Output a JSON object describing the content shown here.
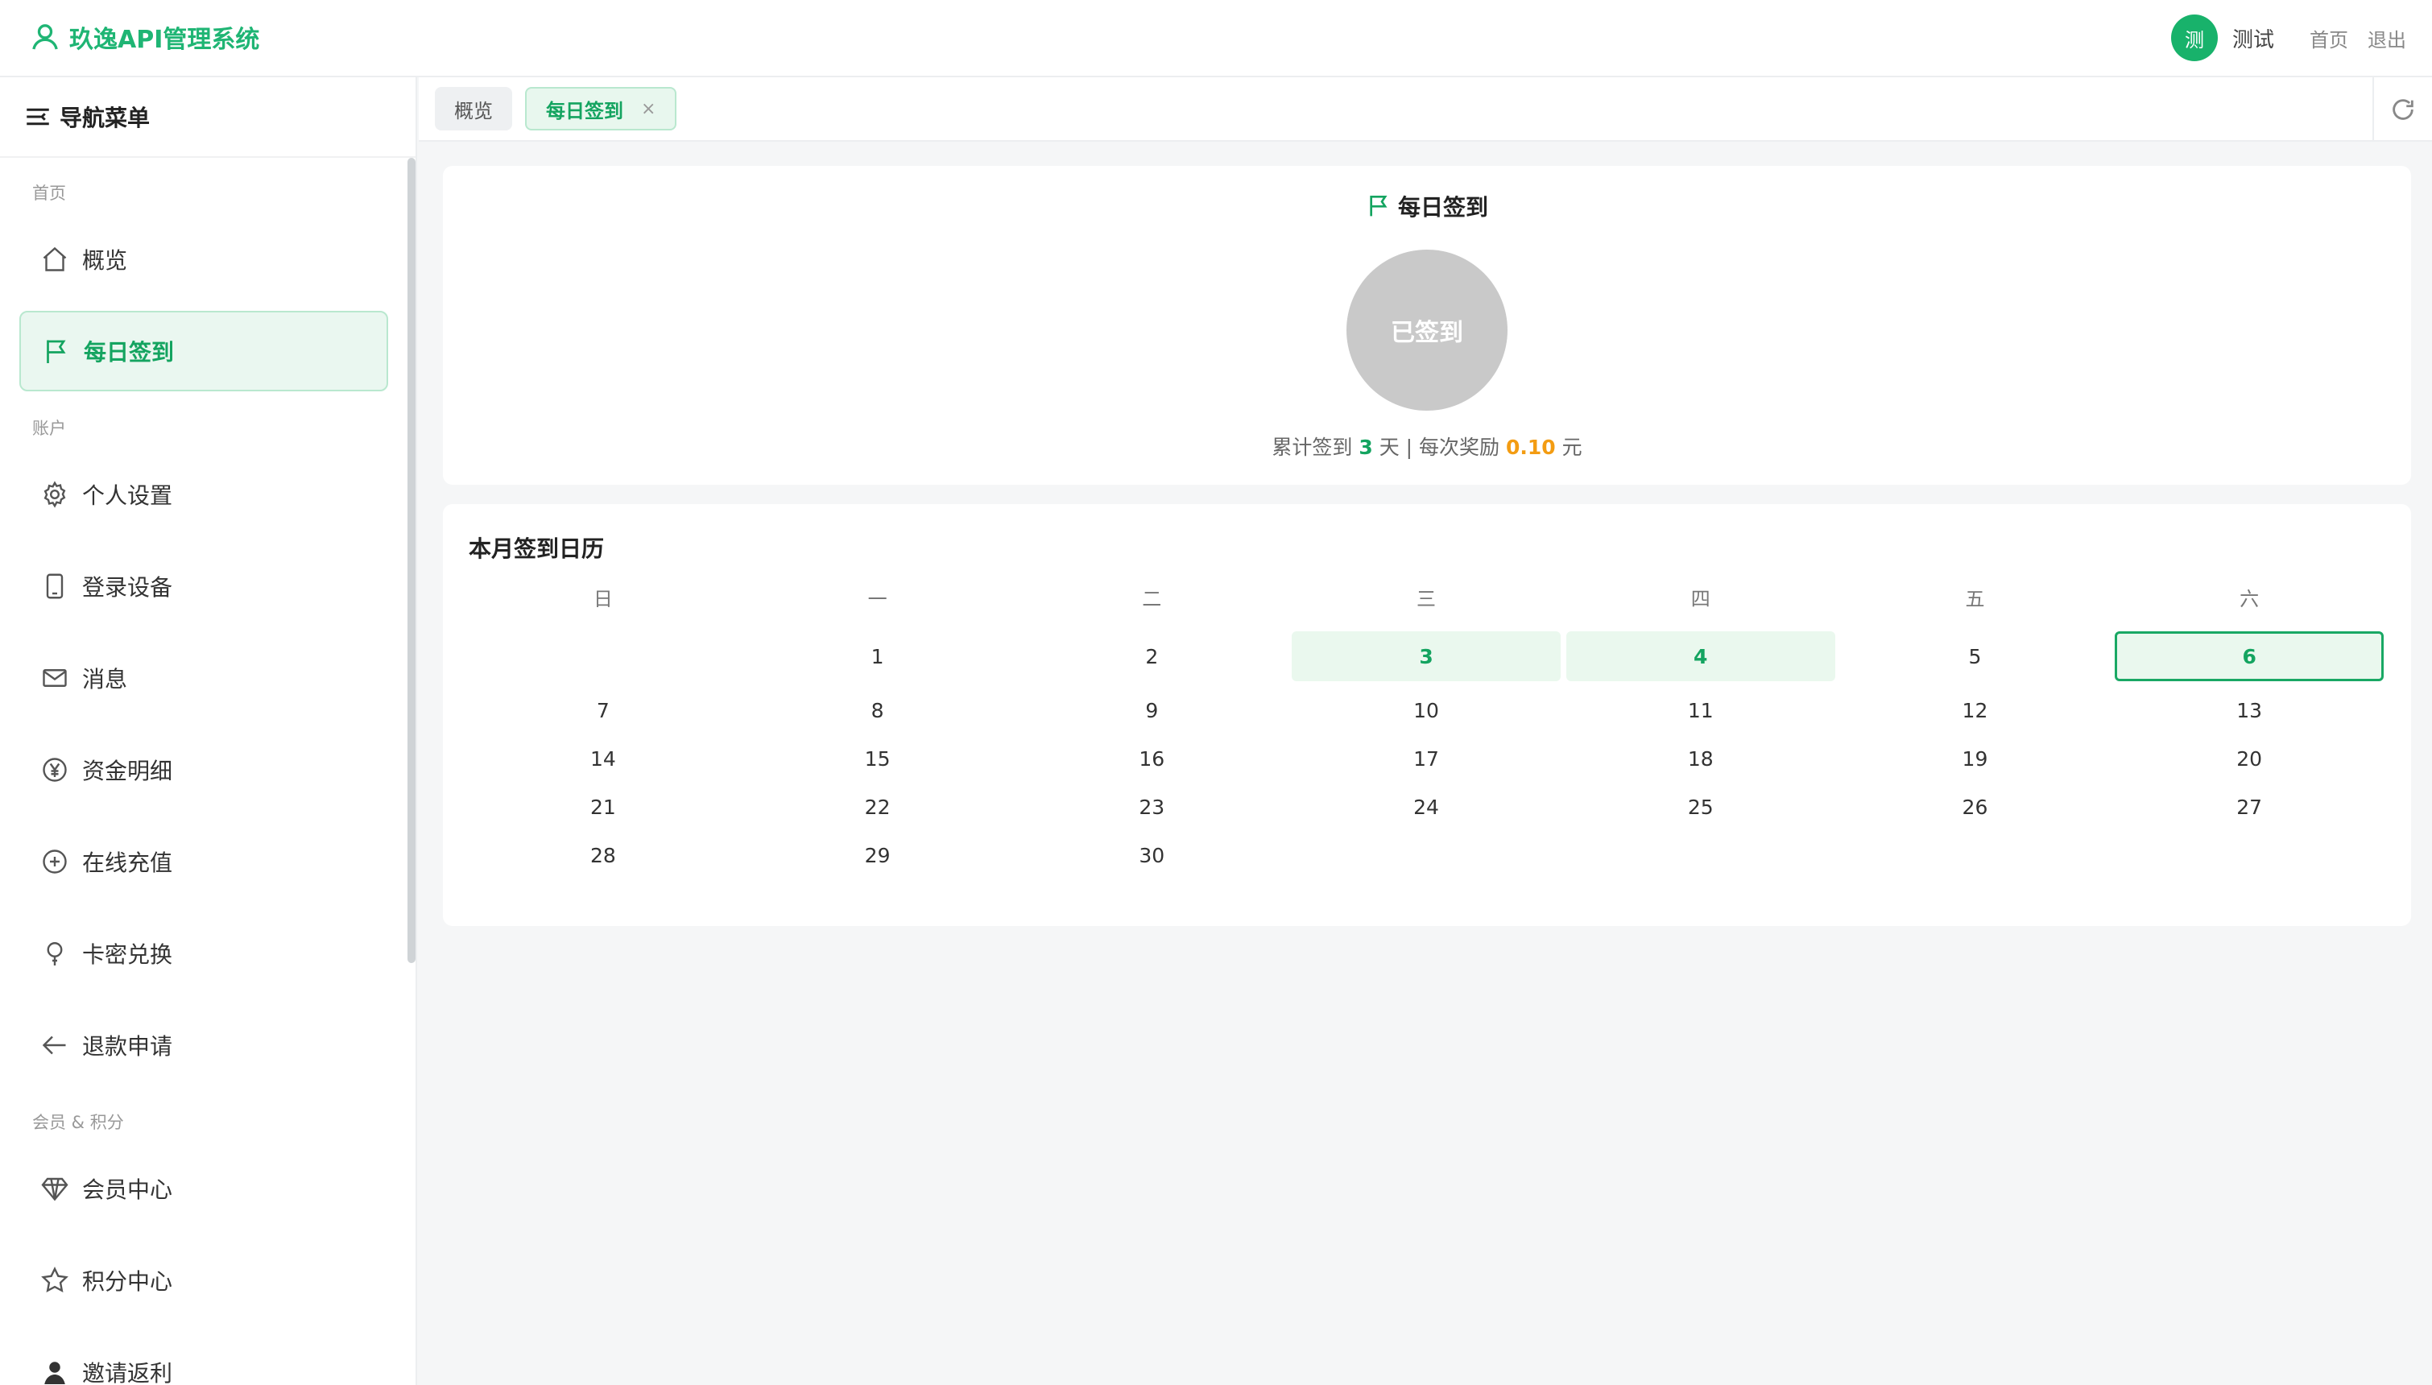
{
  "header": {
    "app_title": "玖逸API管理系统",
    "avatar_text": "测",
    "user_name": "测试",
    "home_link": "首页",
    "logout_link": "退出",
    "brand_color": "#1fb574"
  },
  "sidebar": {
    "heading": "导航菜单",
    "section_home": "首页",
    "section_account": "账户",
    "section_member": "会员 & 积分",
    "items": [
      {
        "label": "概览",
        "icon": "home-icon"
      },
      {
        "label": "每日签到",
        "icon": "flag-icon",
        "active": true
      },
      {
        "label": "个人设置",
        "icon": "gear-icon"
      },
      {
        "label": "登录设备",
        "icon": "phone-icon"
      },
      {
        "label": "消息",
        "icon": "mail-icon"
      },
      {
        "label": "资金明细",
        "icon": "yen-icon"
      },
      {
        "label": "在线充值",
        "icon": "plus-circle-icon"
      },
      {
        "label": "卡密兑换",
        "icon": "bulb-icon"
      },
      {
        "label": "退款申请",
        "icon": "arrow-left-icon"
      },
      {
        "label": "会员中心",
        "icon": "diamond-icon"
      },
      {
        "label": "积分中心",
        "icon": "star-icon"
      },
      {
        "label": "邀请返利",
        "icon": "user-icon"
      }
    ]
  },
  "tabs": {
    "overview": "概览",
    "signin": "每日签到",
    "close": "×"
  },
  "signin": {
    "title": "每日签到",
    "button": "已签到",
    "stats_prefix": "累计签到",
    "days": "3",
    "stats_mid": "天 | 每次奖励",
    "reward": "0.10",
    "unit": "元"
  },
  "calendar": {
    "title": "本月签到日历",
    "weekdays": [
      "日",
      "一",
      "二",
      "三",
      "四",
      "五",
      "六"
    ],
    "rows": [
      [
        "",
        "1",
        "2",
        "3",
        "4",
        "5",
        "6"
      ],
      [
        "7",
        "8",
        "9",
        "10",
        "11",
        "12",
        "13"
      ],
      [
        "14",
        "15",
        "16",
        "17",
        "18",
        "19",
        "20"
      ],
      [
        "21",
        "22",
        "23",
        "24",
        "25",
        "26",
        "27"
      ],
      [
        "28",
        "29",
        "30",
        "",
        "",
        "",
        ""
      ]
    ],
    "signed_days": [
      "3",
      "4",
      "6"
    ],
    "today": "6"
  }
}
